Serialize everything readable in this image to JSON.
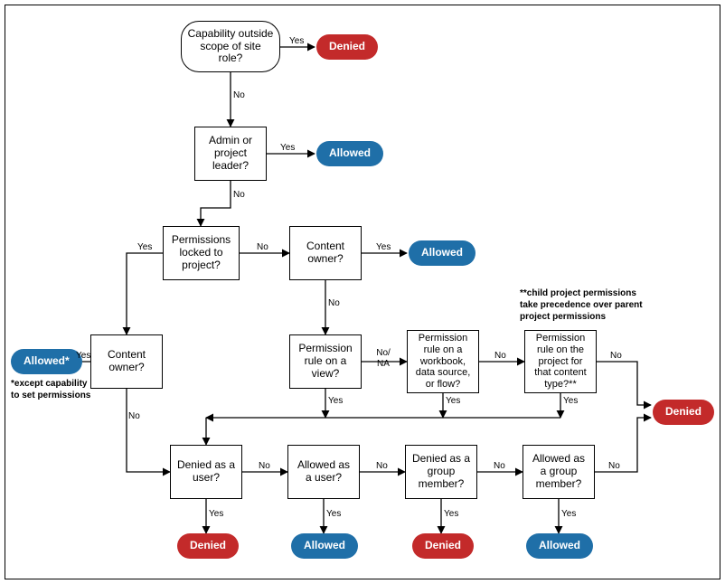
{
  "nodes": {
    "n1": "Capability outside scope of site role?",
    "n2": "Admin or project leader?",
    "n3": "Permissions locked to project?",
    "n4": "Content owner?",
    "n5": "Content owner?",
    "n6": "Permission rule on a view?",
    "n7": "Permission rule on a workbook, data source, or flow?",
    "n8": "Permission rule on the project for that content type?**",
    "n9": "Denied as a user?",
    "n10": "Allowed as a user?",
    "n11": "Denied as a group member?",
    "n12": "Allowed as a group member?"
  },
  "terminals": {
    "t1": "Denied",
    "t2": "Allowed",
    "t3": "Allowed",
    "t4": "Allowed*",
    "t5": "Denied",
    "t6": "Denied",
    "t7": "Allowed",
    "t8": "Denied",
    "t9": "Allowed"
  },
  "labels": {
    "yes": "Yes",
    "no": "No",
    "nona": "No/\nNA"
  },
  "notes": {
    "note1": "*except capability to set permissions",
    "note2": "**child project permissions take precedence over parent project  permissions"
  },
  "chart_data": {
    "type": "flowchart",
    "title": "Permission evaluation flow",
    "nodes": [
      {
        "id": "n1",
        "text": "Capability outside scope of site role?",
        "shape": "rounded-rect"
      },
      {
        "id": "n2",
        "text": "Admin or project leader?",
        "shape": "rect"
      },
      {
        "id": "n3",
        "text": "Permissions locked to project?",
        "shape": "rect"
      },
      {
        "id": "n4",
        "text": "Content owner?",
        "shape": "rect"
      },
      {
        "id": "n5",
        "text": "Content owner?",
        "shape": "rect"
      },
      {
        "id": "n6",
        "text": "Permission rule on a view?",
        "shape": "rect"
      },
      {
        "id": "n7",
        "text": "Permission rule on a workbook, data source, or flow?",
        "shape": "rect"
      },
      {
        "id": "n8",
        "text": "Permission rule on the project for that content type?**",
        "shape": "rect"
      },
      {
        "id": "n9",
        "text": "Denied as a user?",
        "shape": "rect"
      },
      {
        "id": "n10",
        "text": "Allowed as a user?",
        "shape": "rect"
      },
      {
        "id": "n11",
        "text": "Denied as a group member?",
        "shape": "rect"
      },
      {
        "id": "n12",
        "text": "Allowed as a group member?",
        "shape": "rect"
      },
      {
        "id": "t1",
        "text": "Denied",
        "shape": "terminal",
        "result": "denied"
      },
      {
        "id": "t2",
        "text": "Allowed",
        "shape": "terminal",
        "result": "allowed"
      },
      {
        "id": "t3",
        "text": "Allowed",
        "shape": "terminal",
        "result": "allowed"
      },
      {
        "id": "t4",
        "text": "Allowed*",
        "shape": "terminal",
        "result": "allowed",
        "footnote": "*except capability to set permissions"
      },
      {
        "id": "t5",
        "text": "Denied",
        "shape": "terminal",
        "result": "denied"
      },
      {
        "id": "t6",
        "text": "Denied",
        "shape": "terminal",
        "result": "denied"
      },
      {
        "id": "t7",
        "text": "Allowed",
        "shape": "terminal",
        "result": "allowed"
      },
      {
        "id": "t8",
        "text": "Denied",
        "shape": "terminal",
        "result": "denied"
      },
      {
        "id": "t9",
        "text": "Allowed",
        "shape": "terminal",
        "result": "allowed"
      }
    ],
    "edges": [
      {
        "from": "n1",
        "to": "t1",
        "label": "Yes"
      },
      {
        "from": "n1",
        "to": "n2",
        "label": "No"
      },
      {
        "from": "n2",
        "to": "t2",
        "label": "Yes"
      },
      {
        "from": "n2",
        "to": "n3",
        "label": "No"
      },
      {
        "from": "n3",
        "to": "n5",
        "label": "Yes"
      },
      {
        "from": "n3",
        "to": "n4",
        "label": "No"
      },
      {
        "from": "n4",
        "to": "t3",
        "label": "Yes"
      },
      {
        "from": "n4",
        "to": "n6",
        "label": "No"
      },
      {
        "from": "n5",
        "to": "t4",
        "label": "Yes"
      },
      {
        "from": "n5",
        "to": "n9",
        "label": "No"
      },
      {
        "from": "n6",
        "to": "n9",
        "label": "Yes",
        "note": "into denied-as-user check"
      },
      {
        "from": "n6",
        "to": "n7",
        "label": "No/NA"
      },
      {
        "from": "n7",
        "to": "n9",
        "label": "Yes"
      },
      {
        "from": "n7",
        "to": "n8",
        "label": "No"
      },
      {
        "from": "n8",
        "to": "n9",
        "label": "Yes"
      },
      {
        "from": "n8",
        "to": "t5",
        "label": "No"
      },
      {
        "from": "n9",
        "to": "t6",
        "label": "Yes"
      },
      {
        "from": "n9",
        "to": "n10",
        "label": "No"
      },
      {
        "from": "n10",
        "to": "t7",
        "label": "Yes"
      },
      {
        "from": "n10",
        "to": "n11",
        "label": "No"
      },
      {
        "from": "n11",
        "to": "t8",
        "label": "Yes"
      },
      {
        "from": "n11",
        "to": "n12",
        "label": "No"
      },
      {
        "from": "n12",
        "to": "t9",
        "label": "Yes"
      },
      {
        "from": "n12",
        "to": "t5",
        "label": "No"
      }
    ],
    "footnotes": [
      "*except capability to set permissions",
      "**child project permissions take precedence over parent project permissions"
    ]
  }
}
